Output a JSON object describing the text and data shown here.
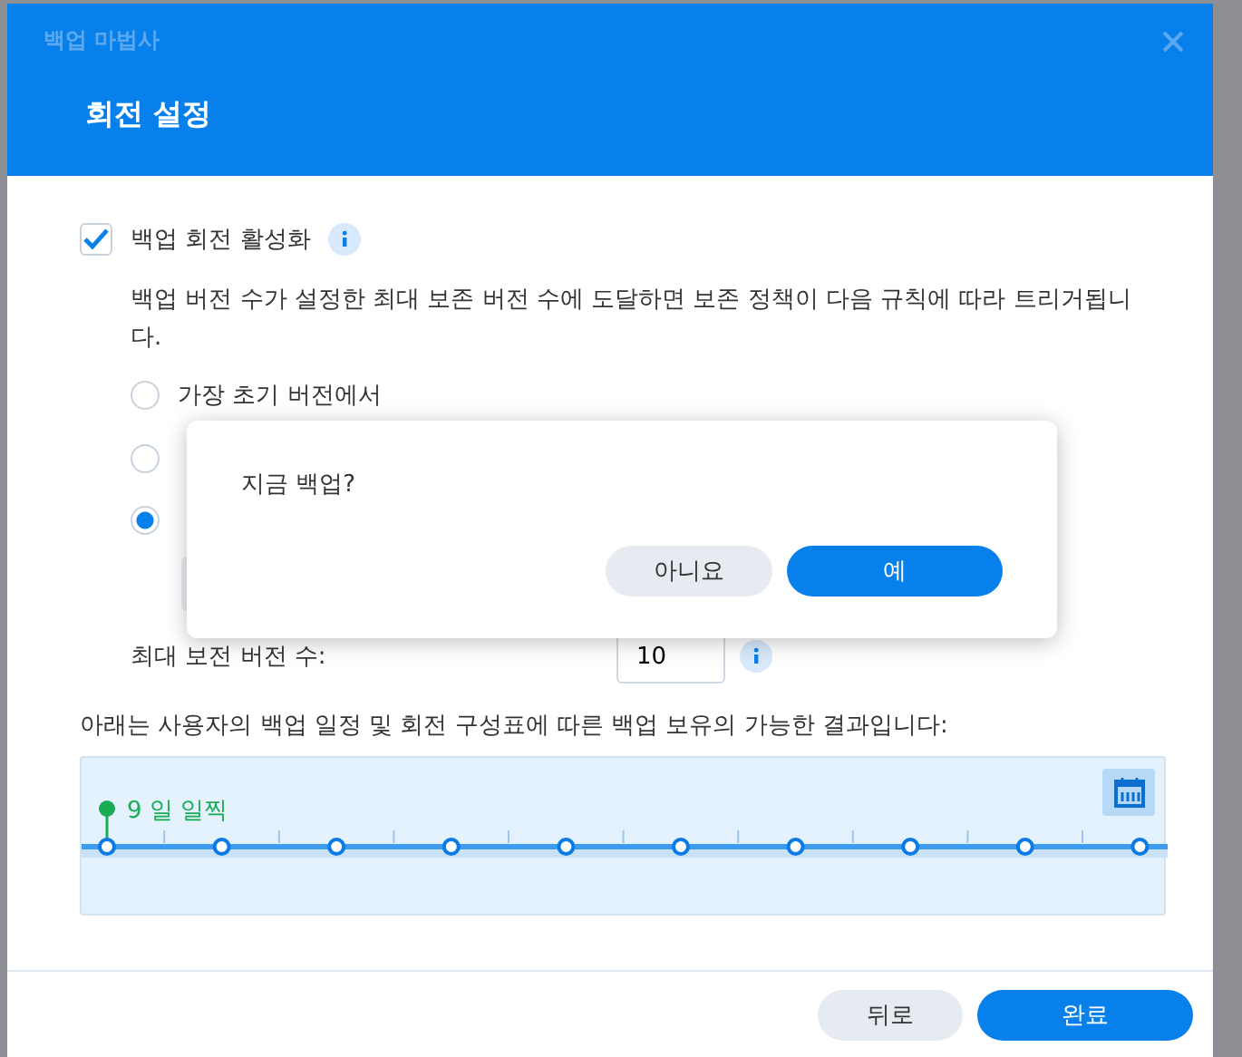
{
  "window": {
    "title": "백업 마법사"
  },
  "header": {
    "title": "회전 설정"
  },
  "rotation": {
    "label": "백업 회전 활성화",
    "checked": true
  },
  "description": "백업 버전 수가 설정한 최대 보존 버전 수에 도달하면 보존 정책이 다음 규칙에 따라 트리거됩니다.",
  "options": [
    {
      "label": "가장 초기 버전에서",
      "selected": false
    },
    {
      "selected": false
    },
    {
      "selected": true
    }
  ],
  "max_versions": {
    "label": "최대 보전 버전 수:",
    "value": "10"
  },
  "preview": {
    "caption": "아래는 사용자의 백업 일정 및 회전 구성표에 따른 백업 보유의 가능한 결과입니다:",
    "marker": "9 일 일찍"
  },
  "footer": {
    "buttons": [
      {
        "label": "뒤로",
        "kind": "secondary"
      },
      {
        "label": "완료",
        "kind": "primary"
      }
    ]
  },
  "confirm": {
    "message": "지금 백업?",
    "buttons": [
      {
        "label": "아니요",
        "kind": "secondary"
      },
      {
        "label": "예",
        "kind": "primary"
      }
    ]
  }
}
